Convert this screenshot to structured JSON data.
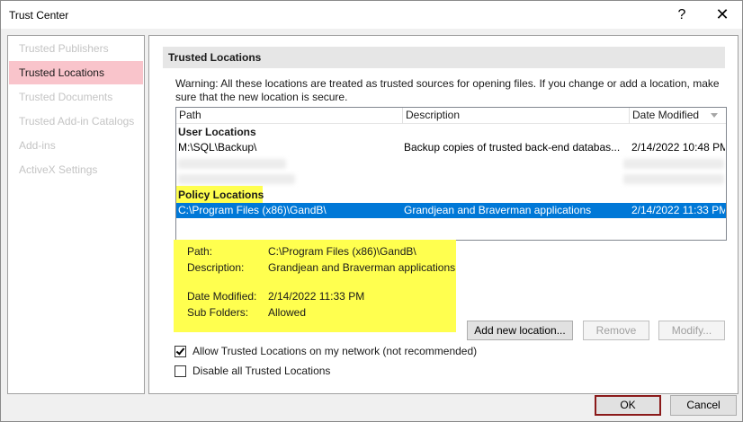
{
  "window": {
    "title": "Trust Center",
    "help_glyph": "?",
    "close_glyph": "✕"
  },
  "nav": {
    "items": [
      {
        "label": "Trusted Publishers",
        "active": false
      },
      {
        "label": "Trusted Locations",
        "active": true
      },
      {
        "label": "Trusted Documents",
        "active": false
      },
      {
        "label": "Trusted Add-in Catalogs",
        "active": false
      },
      {
        "label": "Add-ins",
        "active": false
      },
      {
        "label": "ActiveX Settings",
        "active": false
      }
    ]
  },
  "main": {
    "section_title": "Trusted Locations",
    "warning": "Warning: All these locations are treated as trusted sources for opening files.  If you change or add a location, make sure that the new location is secure.",
    "columns": {
      "path": "Path",
      "description": "Description",
      "date_modified": "Date Modified"
    },
    "user_group": {
      "label": "User Locations",
      "rows": [
        {
          "path": "M:\\SQL\\Backup\\",
          "description": "Backup copies of trusted back-end databas...",
          "date": "2/14/2022 10:48 PM"
        }
      ]
    },
    "policy_group": {
      "label": "Policy Locations",
      "rows": [
        {
          "path": "C:\\Program Files (x86)\\GandB\\",
          "description": "Grandjean and Braverman applications",
          "date": "2/14/2022 11:33 PM",
          "selected": true
        }
      ]
    },
    "details": {
      "path_label": "Path:",
      "path_value": "C:\\Program Files (x86)\\GandB\\",
      "description_label": "Description:",
      "description_value": "Grandjean and Braverman applications",
      "date_label": "Date Modified:",
      "date_value": "2/14/2022 11:33 PM",
      "subfolders_label": "Sub Folders:",
      "subfolders_value": "Allowed"
    },
    "buttons": {
      "add": "Add new location...",
      "remove": "Remove",
      "modify": "Modify..."
    },
    "checkboxes": [
      {
        "label": "Allow Trusted Locations on my network (not recommended)",
        "checked": true
      },
      {
        "label": "Disable all Trusted Locations",
        "checked": false
      }
    ]
  },
  "footer": {
    "ok": "OK",
    "cancel": "Cancel"
  },
  "colors": {
    "selection": "#0078d7",
    "highlight": "#ffff4f",
    "nav_active": "#f9c4cb",
    "ok_border": "#8b1a1a"
  }
}
